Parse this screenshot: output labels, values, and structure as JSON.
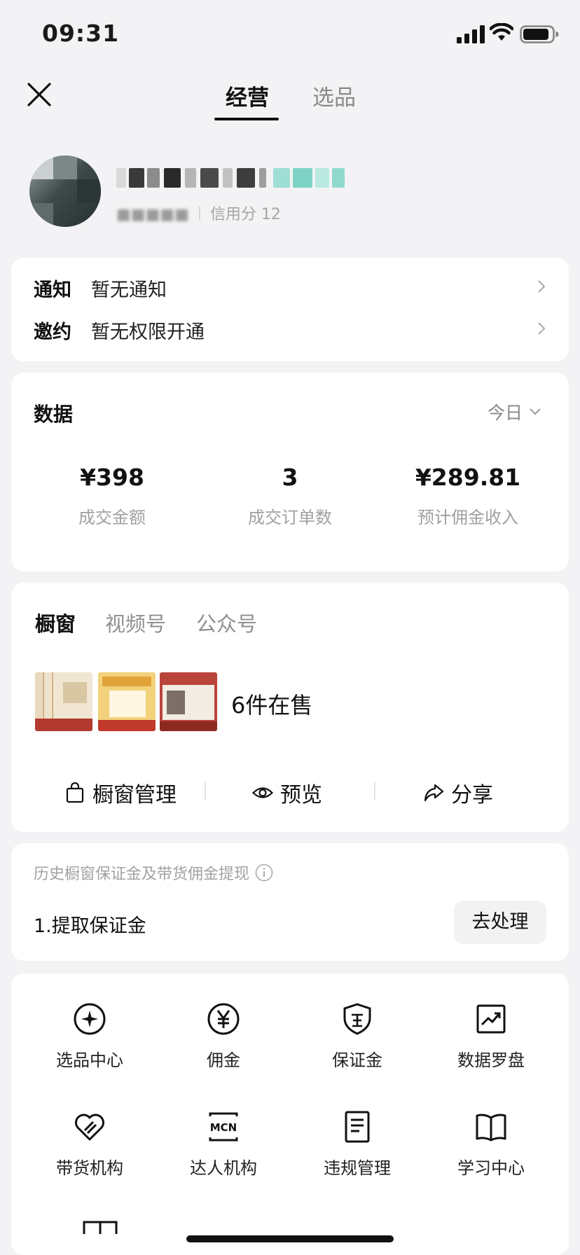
{
  "status_bar": {
    "time": "09:31"
  },
  "nav": {
    "tabs": [
      "经营",
      "选品"
    ]
  },
  "profile": {
    "sub_credit": "信用分 12"
  },
  "notices": [
    {
      "label": "通知",
      "value": "暂无通知"
    },
    {
      "label": "邀约",
      "value": "暂无权限开通"
    }
  ],
  "data_card": {
    "title": "数据",
    "period": "今日",
    "stats": [
      {
        "value": "¥398",
        "label": "成交金额"
      },
      {
        "value": "3",
        "label": "成交订单数"
      },
      {
        "value": "¥289.81",
        "label": "预计佣金收入"
      }
    ]
  },
  "window_card": {
    "tabs": [
      "橱窗",
      "视频号",
      "公众号"
    ],
    "on_sale": "6件在售",
    "actions": [
      "橱窗管理",
      "预览",
      "分享"
    ]
  },
  "deposit_card": {
    "hint": "历史橱窗保证金及带货佣金提现",
    "item": "1.提取保证金",
    "button": "去处理"
  },
  "tools": [
    {
      "label": "选品中心",
      "icon": "select-center-icon"
    },
    {
      "label": "佣金",
      "icon": "yuan-icon"
    },
    {
      "label": "保证金",
      "icon": "shield-icon"
    },
    {
      "label": "数据罗盘",
      "icon": "trend-chart-icon"
    },
    {
      "label": "带货机构",
      "icon": "handshake-heart-icon"
    },
    {
      "label": "达人机构",
      "icon": "mcn-icon"
    },
    {
      "label": "违规管理",
      "icon": "document-icon"
    },
    {
      "label": "学习中心",
      "icon": "book-icon"
    }
  ]
}
